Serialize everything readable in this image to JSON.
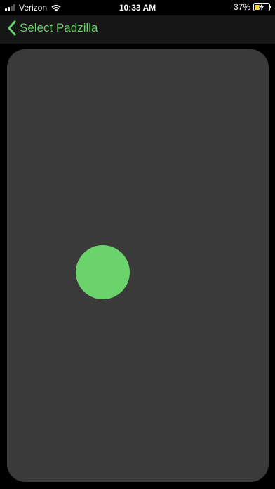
{
  "status_bar": {
    "carrier": "Verizon",
    "time": "10:33 AM",
    "battery_percent": "37%",
    "battery_level": 0.37,
    "signal_bars_active": 2,
    "signal_bars_total": 4,
    "icons": [
      "signal-icon",
      "wifi-icon",
      "battery-icon",
      "charging-bolt-icon"
    ]
  },
  "nav": {
    "back_label": "Select Padzilla",
    "back_icon": "chevron-left-icon"
  },
  "colors": {
    "accent": "#6bd36b",
    "background": "#000000",
    "nav_background": "#161616",
    "pad_background": "#3a3a3a",
    "battery_fill": "#f4d13b"
  }
}
